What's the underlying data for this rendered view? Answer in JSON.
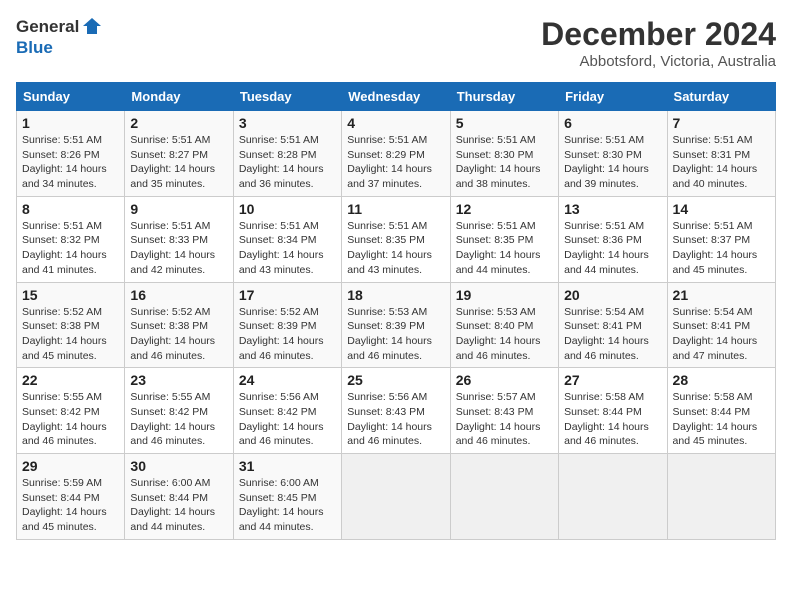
{
  "header": {
    "logo_line1": "General",
    "logo_line2": "Blue",
    "month": "December 2024",
    "location": "Abbotsford, Victoria, Australia"
  },
  "days_of_week": [
    "Sunday",
    "Monday",
    "Tuesday",
    "Wednesday",
    "Thursday",
    "Friday",
    "Saturday"
  ],
  "weeks": [
    [
      {
        "day": "1",
        "sunrise": "5:51 AM",
        "sunset": "8:26 PM",
        "daylight": "14 hours and 34 minutes."
      },
      {
        "day": "2",
        "sunrise": "5:51 AM",
        "sunset": "8:27 PM",
        "daylight": "14 hours and 35 minutes."
      },
      {
        "day": "3",
        "sunrise": "5:51 AM",
        "sunset": "8:28 PM",
        "daylight": "14 hours and 36 minutes."
      },
      {
        "day": "4",
        "sunrise": "5:51 AM",
        "sunset": "8:29 PM",
        "daylight": "14 hours and 37 minutes."
      },
      {
        "day": "5",
        "sunrise": "5:51 AM",
        "sunset": "8:30 PM",
        "daylight": "14 hours and 38 minutes."
      },
      {
        "day": "6",
        "sunrise": "5:51 AM",
        "sunset": "8:30 PM",
        "daylight": "14 hours and 39 minutes."
      },
      {
        "day": "7",
        "sunrise": "5:51 AM",
        "sunset": "8:31 PM",
        "daylight": "14 hours and 40 minutes."
      }
    ],
    [
      {
        "day": "8",
        "sunrise": "5:51 AM",
        "sunset": "8:32 PM",
        "daylight": "14 hours and 41 minutes."
      },
      {
        "day": "9",
        "sunrise": "5:51 AM",
        "sunset": "8:33 PM",
        "daylight": "14 hours and 42 minutes."
      },
      {
        "day": "10",
        "sunrise": "5:51 AM",
        "sunset": "8:34 PM",
        "daylight": "14 hours and 43 minutes."
      },
      {
        "day": "11",
        "sunrise": "5:51 AM",
        "sunset": "8:35 PM",
        "daylight": "14 hours and 43 minutes."
      },
      {
        "day": "12",
        "sunrise": "5:51 AM",
        "sunset": "8:35 PM",
        "daylight": "14 hours and 44 minutes."
      },
      {
        "day": "13",
        "sunrise": "5:51 AM",
        "sunset": "8:36 PM",
        "daylight": "14 hours and 44 minutes."
      },
      {
        "day": "14",
        "sunrise": "5:51 AM",
        "sunset": "8:37 PM",
        "daylight": "14 hours and 45 minutes."
      }
    ],
    [
      {
        "day": "15",
        "sunrise": "5:52 AM",
        "sunset": "8:38 PM",
        "daylight": "14 hours and 45 minutes."
      },
      {
        "day": "16",
        "sunrise": "5:52 AM",
        "sunset": "8:38 PM",
        "daylight": "14 hours and 46 minutes."
      },
      {
        "day": "17",
        "sunrise": "5:52 AM",
        "sunset": "8:39 PM",
        "daylight": "14 hours and 46 minutes."
      },
      {
        "day": "18",
        "sunrise": "5:53 AM",
        "sunset": "8:39 PM",
        "daylight": "14 hours and 46 minutes."
      },
      {
        "day": "19",
        "sunrise": "5:53 AM",
        "sunset": "8:40 PM",
        "daylight": "14 hours and 46 minutes."
      },
      {
        "day": "20",
        "sunrise": "5:54 AM",
        "sunset": "8:41 PM",
        "daylight": "14 hours and 46 minutes."
      },
      {
        "day": "21",
        "sunrise": "5:54 AM",
        "sunset": "8:41 PM",
        "daylight": "14 hours and 47 minutes."
      }
    ],
    [
      {
        "day": "22",
        "sunrise": "5:55 AM",
        "sunset": "8:42 PM",
        "daylight": "14 hours and 46 minutes."
      },
      {
        "day": "23",
        "sunrise": "5:55 AM",
        "sunset": "8:42 PM",
        "daylight": "14 hours and 46 minutes."
      },
      {
        "day": "24",
        "sunrise": "5:56 AM",
        "sunset": "8:42 PM",
        "daylight": "14 hours and 46 minutes."
      },
      {
        "day": "25",
        "sunrise": "5:56 AM",
        "sunset": "8:43 PM",
        "daylight": "14 hours and 46 minutes."
      },
      {
        "day": "26",
        "sunrise": "5:57 AM",
        "sunset": "8:43 PM",
        "daylight": "14 hours and 46 minutes."
      },
      {
        "day": "27",
        "sunrise": "5:58 AM",
        "sunset": "8:44 PM",
        "daylight": "14 hours and 46 minutes."
      },
      {
        "day": "28",
        "sunrise": "5:58 AM",
        "sunset": "8:44 PM",
        "daylight": "14 hours and 45 minutes."
      }
    ],
    [
      {
        "day": "29",
        "sunrise": "5:59 AM",
        "sunset": "8:44 PM",
        "daylight": "14 hours and 45 minutes."
      },
      {
        "day": "30",
        "sunrise": "6:00 AM",
        "sunset": "8:44 PM",
        "daylight": "14 hours and 44 minutes."
      },
      {
        "day": "31",
        "sunrise": "6:00 AM",
        "sunset": "8:45 PM",
        "daylight": "14 hours and 44 minutes."
      },
      null,
      null,
      null,
      null
    ]
  ]
}
